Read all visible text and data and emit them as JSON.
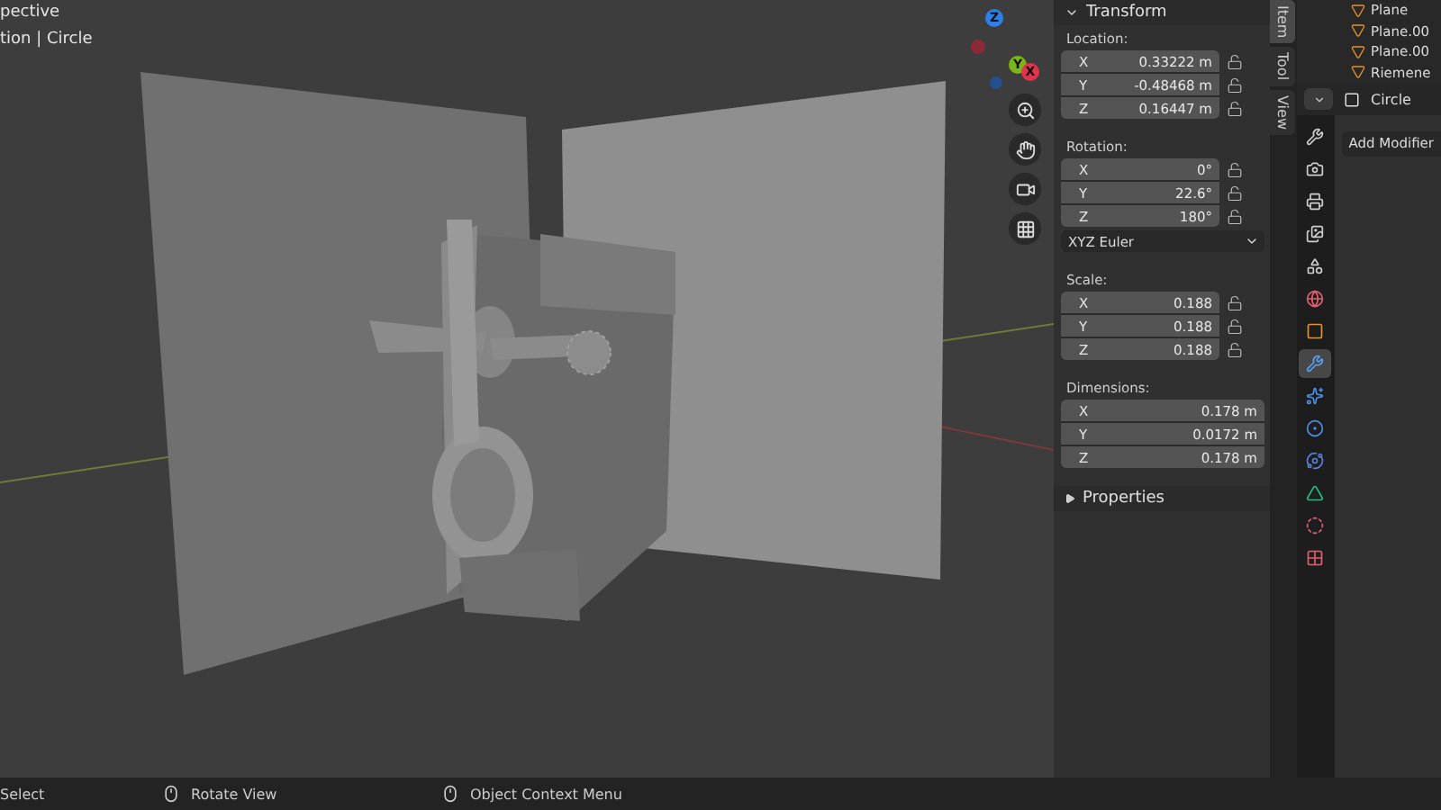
{
  "viewport": {
    "header_lines": [
      "pective",
      "tion | Circle"
    ],
    "gizmo": [
      {
        "label": "Z",
        "kind": "z"
      },
      {
        "label": "Y",
        "kind": "y"
      },
      {
        "label": "X",
        "kind": "x"
      }
    ],
    "nav_tools": [
      {
        "kind": "zoom"
      },
      {
        "kind": "pan"
      },
      {
        "kind": "camera"
      },
      {
        "kind": "ortho"
      }
    ]
  },
  "sidebar": {
    "sections": [
      {
        "title": "Transform",
        "expanded": true,
        "groups": [
          {
            "label": "Location:",
            "locks": true,
            "rows": [
              {
                "axis": "X",
                "value": "0.33222 m"
              },
              {
                "axis": "Y",
                "value": "-0.48468 m"
              },
              {
                "axis": "Z",
                "value": "0.16447 m"
              }
            ]
          },
          {
            "label": "Rotation:",
            "locks": true,
            "rows": [
              {
                "axis": "X",
                "value": "0°"
              },
              {
                "axis": "Y",
                "value": "22.6°"
              },
              {
                "axis": "Z",
                "value": "180°"
              }
            ],
            "mode": "XYZ Euler"
          },
          {
            "label": "Scale:",
            "locks": true,
            "rows": [
              {
                "axis": "X",
                "value": "0.188"
              },
              {
                "axis": "Y",
                "value": "0.188"
              },
              {
                "axis": "Z",
                "value": "0.188"
              }
            ]
          },
          {
            "label": "Dimensions:",
            "locks": false,
            "rows": [
              {
                "axis": "X",
                "value": "0.178 m"
              },
              {
                "axis": "Y",
                "value": "0.0172 m"
              },
              {
                "axis": "Z",
                "value": "0.178 m"
              }
            ]
          }
        ]
      },
      {
        "title": "Properties",
        "expanded": false
      }
    ],
    "tabs": [
      {
        "label": "Item",
        "selected": true
      },
      {
        "label": "Tool",
        "selected": false
      },
      {
        "label": "View",
        "selected": false
      }
    ]
  },
  "outliner": {
    "rows": [
      {
        "name": "Plane"
      },
      {
        "name": "Plane.00"
      },
      {
        "name": "Plane.00"
      },
      {
        "name": "Riemene"
      }
    ]
  },
  "properties": {
    "object_name": "Circle",
    "add_button": "Add Modifier",
    "tabs": [
      {
        "kind": "tool",
        "selected": false
      },
      {
        "kind": "render",
        "selected": false
      },
      {
        "kind": "output",
        "selected": false
      },
      {
        "kind": "view_layer",
        "selected": false
      },
      {
        "kind": "scene",
        "selected": false
      },
      {
        "kind": "world",
        "selected": false
      },
      {
        "kind": "object",
        "selected": false
      },
      {
        "kind": "modifier",
        "selected": true
      },
      {
        "kind": "particles",
        "selected": false
      },
      {
        "kind": "physics",
        "selected": false
      },
      {
        "kind": "constraints",
        "selected": false
      },
      {
        "kind": "data",
        "selected": false
      },
      {
        "kind": "material",
        "selected": false
      },
      {
        "kind": "texture",
        "selected": false
      }
    ]
  },
  "status_bar": [
    {
      "kind": "key",
      "label": "Select"
    },
    {
      "kind": "mouse",
      "label": "Rotate View"
    },
    {
      "kind": "mouse",
      "label": "Object Context Menu"
    }
  ]
}
